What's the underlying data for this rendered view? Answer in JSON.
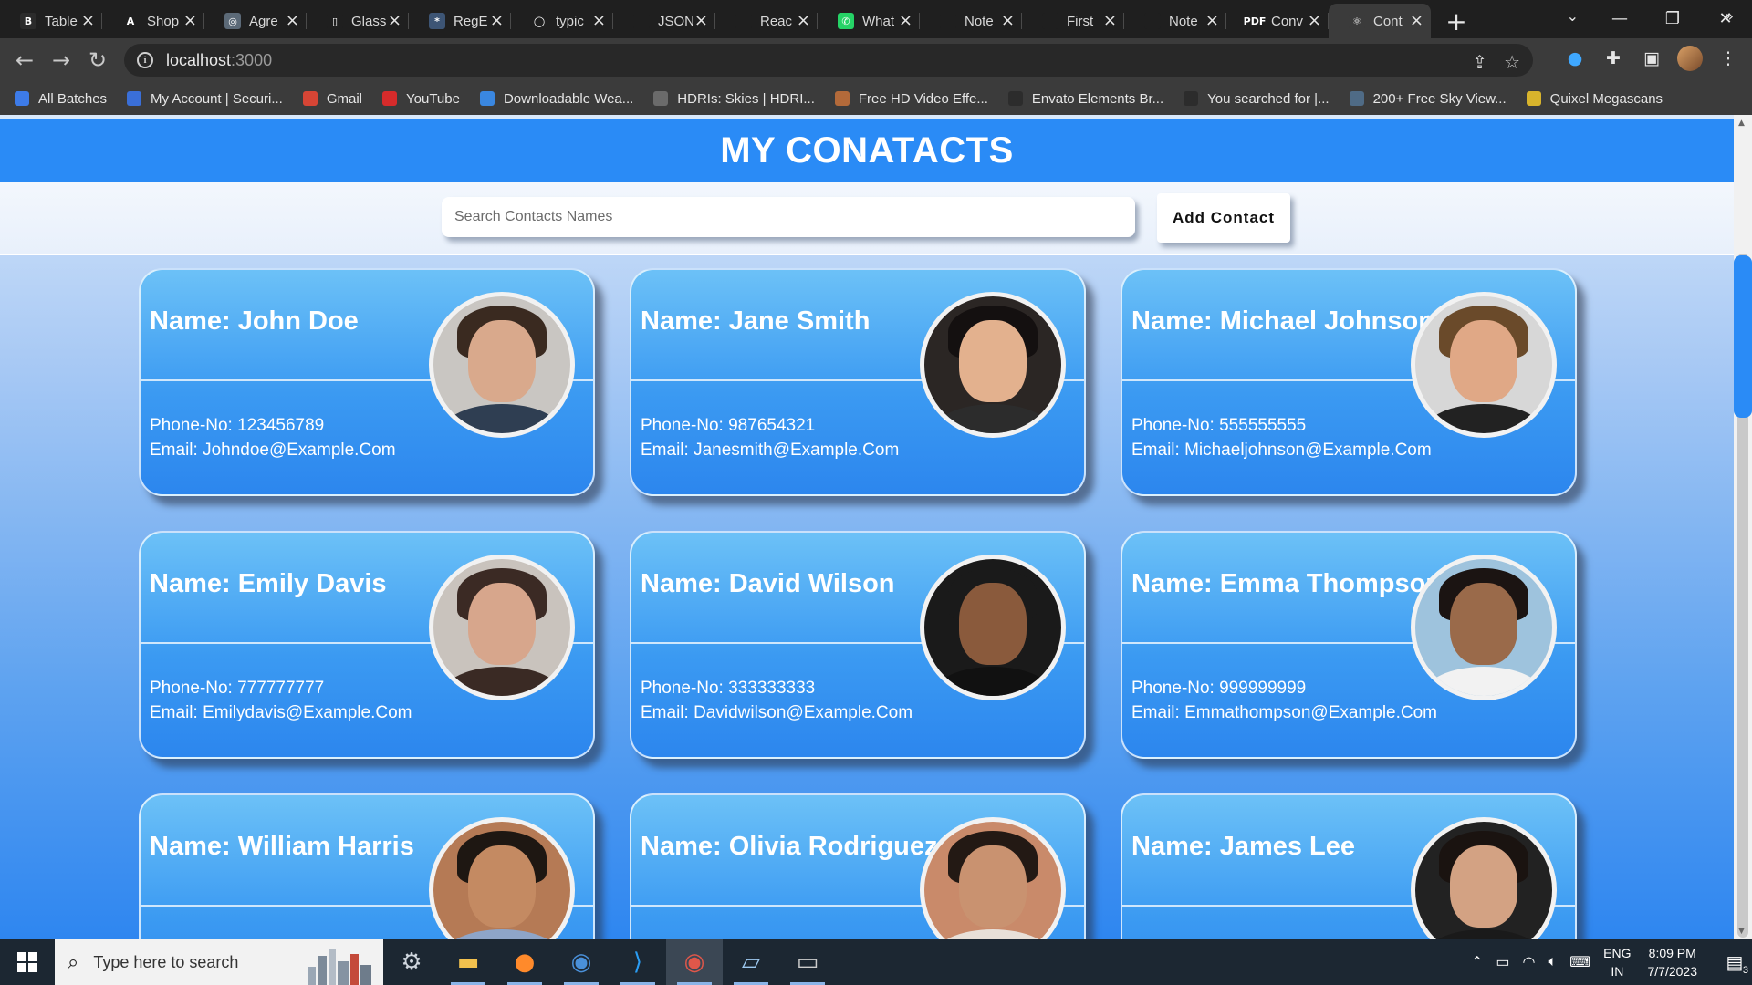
{
  "browser": {
    "tabs": [
      {
        "title": "Table",
        "favicon": "bootstrap-icon",
        "fav_color": "#2b2b2b",
        "fav_text": "B"
      },
      {
        "title": "Shop",
        "favicon": "a-letter-icon",
        "fav_color": "#1f1f1f",
        "fav_text": "A"
      },
      {
        "title": "Agre",
        "favicon": "openai-icon",
        "fav_color": "#5c6a78",
        "fav_text": "◎"
      },
      {
        "title": "Glass",
        "favicon": "phone-outline-icon",
        "fav_color": "#1f1f1f",
        "fav_text": "▯"
      },
      {
        "title": "RegE",
        "favicon": "regex-icon",
        "fav_color": "#3d5575",
        "fav_text": "*"
      },
      {
        "title": "typic",
        "favicon": "github-icon",
        "fav_color": "#1f1f1f",
        "fav_text": "◯"
      },
      {
        "title": "JSON",
        "favicon": "json-icon",
        "fav_color": "#1f1f1f",
        "fav_text": ""
      },
      {
        "title": "Reac",
        "favicon": "react-icon",
        "fav_color": "#1f1f1f",
        "fav_text": ""
      },
      {
        "title": "What",
        "favicon": "whatsapp-icon",
        "fav_color": "#25d366",
        "fav_text": "✆"
      },
      {
        "title": "Note",
        "favicon": "notes-icon",
        "fav_color": "#1f1f1f",
        "fav_text": ""
      },
      {
        "title": "First",
        "favicon": "page-icon",
        "fav_color": "#1f1f1f",
        "fav_text": ""
      },
      {
        "title": "Note",
        "favicon": "notes-icon",
        "fav_color": "#1f1f1f",
        "fav_text": ""
      },
      {
        "title": "Conv",
        "favicon": "pdf-icon",
        "fav_color": "#1f1f1f",
        "fav_text": "PDF"
      },
      {
        "title": "Cont",
        "favicon": "react-icon",
        "fav_color": "#3b3b3b",
        "fav_text": "⚛",
        "active": true
      }
    ],
    "url_host": "localhost",
    "url_port": ":3000",
    "bookmarks": [
      {
        "label": "All Batches",
        "icon": "pw-icon",
        "color": "#3d7be8"
      },
      {
        "label": "My Account | Securi...",
        "icon": "shield-icon",
        "color": "#3a6fd8"
      },
      {
        "label": "Gmail",
        "icon": "gmail-icon",
        "color": "#d64535"
      },
      {
        "label": "YouTube",
        "icon": "youtube-icon",
        "color": "#d62b2b"
      },
      {
        "label": "Downloadable Wea...",
        "icon": "globe-icon",
        "color": "#3a87e0"
      },
      {
        "label": "HDRIs: Skies | HDRI...",
        "icon": "hdri-icon",
        "color": "#6b6b6b"
      },
      {
        "label": "Free HD Video Effe...",
        "icon": "effects-icon",
        "color": "#b36a3a"
      },
      {
        "label": "Envato Elements Br...",
        "icon": "envato-icon",
        "color": "#2c2c2c"
      },
      {
        "label": "You searched for |...",
        "icon": "envato-icon",
        "color": "#2c2c2c"
      },
      {
        "label": "200+ Free Sky View...",
        "icon": "px-icon",
        "color": "#4f6b86"
      },
      {
        "label": "Quixel Megascans",
        "icon": "quixel-icon",
        "color": "#d8b42c"
      }
    ]
  },
  "app": {
    "title": "MY CONATACTS",
    "search_placeholder": "Search Contacts Names",
    "add_button": "Add Contact"
  },
  "contacts": [
    {
      "name": "Name: John Doe",
      "phone": "Phone-No: 123456789",
      "email": "Email: Johndoe@Example.Com",
      "photo": {
        "bg": "#c9c6c2",
        "skin": "#d9a98c",
        "hair": "#3a2a20",
        "shirt": "#2f3e52"
      }
    },
    {
      "name": "Name: Jane Smith",
      "phone": "Phone-No: 987654321",
      "email": "Email: Janesmith@Example.Com",
      "photo": {
        "bg": "#2b2624",
        "skin": "#e3b18e",
        "hair": "#141010",
        "shirt": "#2c2c2c"
      }
    },
    {
      "name": "Name: Michael Johnson",
      "phone": "Phone-No: 555555555",
      "email": "Email: Michaeljohnson@Example.Com",
      "photo": {
        "bg": "#d7d7d7",
        "skin": "#e0a886",
        "hair": "#6a4a2a",
        "shirt": "#222222"
      }
    },
    {
      "name": "Name: Emily Davis",
      "phone": "Phone-No: 777777777",
      "email": "Email: Emilydavis@Example.Com",
      "photo": {
        "bg": "#c9c3bd",
        "skin": "#d7a68c",
        "hair": "#3b2a24",
        "shirt": "#3a2a24"
      }
    },
    {
      "name": "Name: David Wilson",
      "phone": "Phone-No: 333333333",
      "email": "Email: Davidwilson@Example.Com",
      "photo": {
        "bg": "#1a1a1a",
        "skin": "#8a5a3c",
        "hair": "#1a1a1a",
        "shirt": "#111111"
      }
    },
    {
      "name": "Name: Emma Thompson",
      "phone": "Phone-No: 999999999",
      "email": "Email: Emmathompson@Example.Com",
      "photo": {
        "bg": "#9ec3dd",
        "skin": "#9a6a4a",
        "hair": "#1b1412",
        "shirt": "#f2f2f2"
      }
    },
    {
      "name": "Name: William Harris",
      "phone": "",
      "email": "",
      "photo": {
        "bg": "#b57a55",
        "skin": "#c48a62",
        "hair": "#1e1712",
        "shirt": "#8ea5c8"
      }
    },
    {
      "name": "Name: Olivia Rodriguez",
      "phone": "",
      "email": "",
      "photo": {
        "bg": "#c98a6a",
        "skin": "#c99270",
        "hair": "#231914",
        "shirt": "#e8e0d8"
      }
    },
    {
      "name": "Name: James Lee",
      "phone": "",
      "email": "",
      "photo": {
        "bg": "#222222",
        "skin": "#d3a283",
        "hair": "#1a1310",
        "shirt": "#1a1a1a"
      }
    }
  ],
  "taskbar": {
    "search_text": "Type here to search",
    "apps": [
      "settings-icon",
      "file-explorer-icon",
      "firefox-icon",
      "chrome-profile-icon",
      "vscode-icon",
      "chrome-icon",
      "notepad-icon",
      "terminal-icon"
    ],
    "lang_top": "ENG",
    "lang_bottom": "IN",
    "time": "8:09 PM",
    "date": "7/7/2023",
    "notifications": "3"
  }
}
